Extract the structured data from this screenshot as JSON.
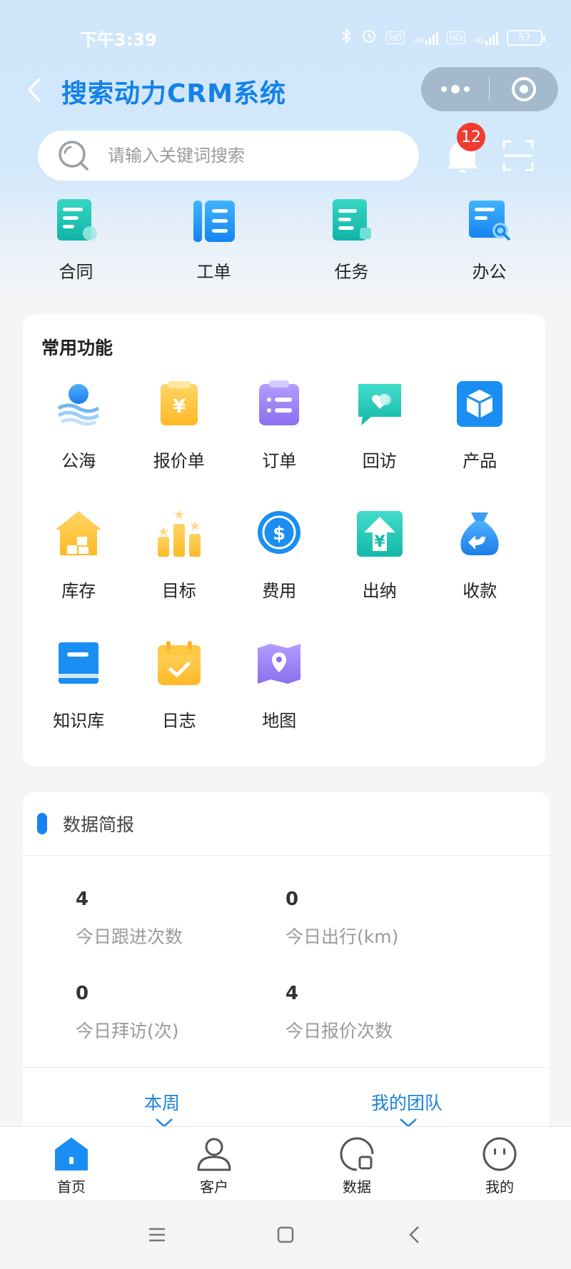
{
  "status_bar": {
    "time": "下午3:39",
    "network_1": "4G",
    "network_2": "4G",
    "hd": "HD",
    "battery": "57"
  },
  "header": {
    "title": "搜索动力CRM系统"
  },
  "search": {
    "placeholder": "请输入关键词搜索"
  },
  "notifications": {
    "count": "12"
  },
  "quick_items": [
    {
      "label": "合同",
      "icon": "contract-icon"
    },
    {
      "label": "工单",
      "icon": "work-order-icon"
    },
    {
      "label": "任务",
      "icon": "task-icon"
    },
    {
      "label": "办公",
      "icon": "office-icon"
    }
  ],
  "common": {
    "title": "常用功能",
    "rows": [
      [
        {
          "label": "公海",
          "icon": "public-sea-icon"
        },
        {
          "label": "报价单",
          "icon": "quote-icon"
        },
        {
          "label": "订单",
          "icon": "order-icon"
        },
        {
          "label": "回访",
          "icon": "revisit-icon"
        },
        {
          "label": "产品",
          "icon": "product-icon"
        }
      ],
      [
        {
          "label": "库存",
          "icon": "inventory-icon"
        },
        {
          "label": "目标",
          "icon": "target-icon"
        },
        {
          "label": "费用",
          "icon": "expense-icon"
        },
        {
          "label": "出纳",
          "icon": "cashier-icon"
        },
        {
          "label": "收款",
          "icon": "collection-icon"
        }
      ],
      [
        {
          "label": "知识库",
          "icon": "knowledge-base-icon"
        },
        {
          "label": "日志",
          "icon": "log-icon"
        },
        {
          "label": "地图",
          "icon": "map-icon"
        }
      ]
    ]
  },
  "data_brief": {
    "title": "数据简报",
    "stats": [
      {
        "value": "4",
        "label": "今日跟进次数"
      },
      {
        "value": "0",
        "label": "今日出行(km)"
      },
      {
        "value": "0",
        "label": "今日拜访(次)"
      },
      {
        "value": "4",
        "label": "今日报价次数"
      }
    ],
    "period_selector": "本周",
    "scope_selector": "我的团队"
  },
  "bottom_nav": [
    {
      "label": "首页",
      "icon": "home-icon",
      "active": true
    },
    {
      "label": "客户",
      "icon": "customer-icon",
      "active": false
    },
    {
      "label": "数据",
      "icon": "data-icon",
      "active": false
    },
    {
      "label": "我的",
      "icon": "profile-icon",
      "active": false
    }
  ],
  "colors": {
    "brand": "#1481e8",
    "badge": "#f03c2e",
    "accent_blue": "#1982f0"
  }
}
